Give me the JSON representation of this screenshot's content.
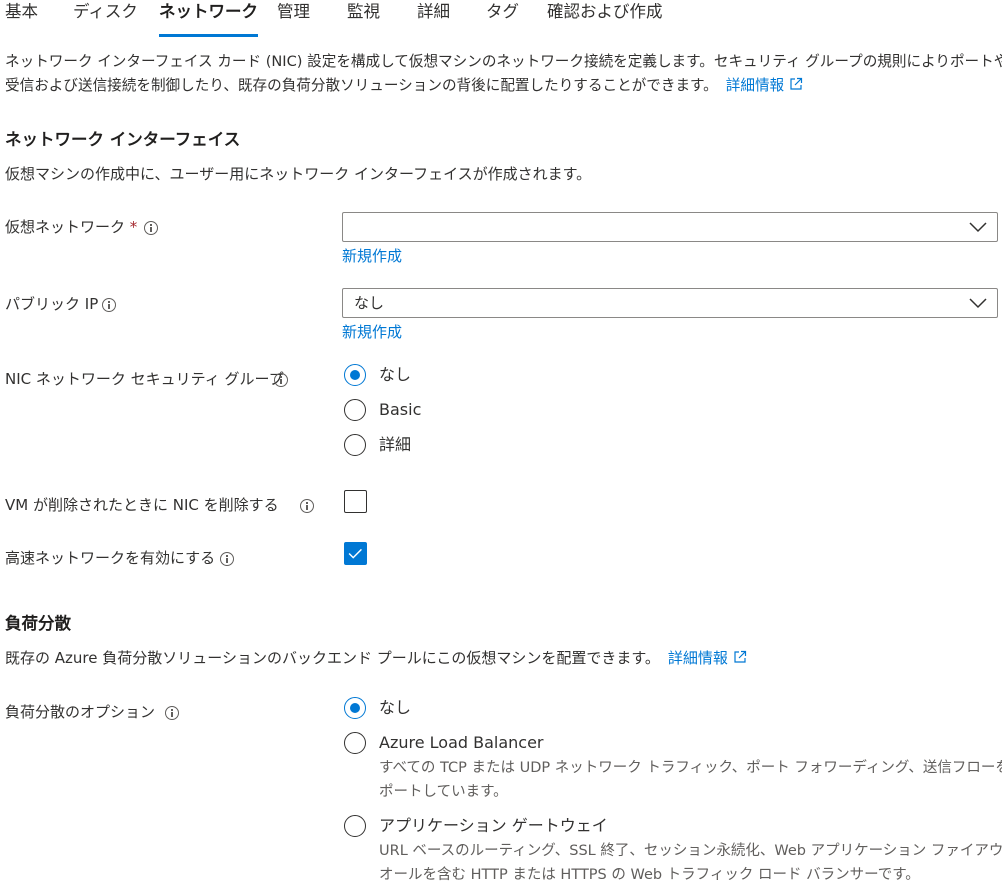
{
  "tabs": [
    {
      "label": "基本",
      "active": false
    },
    {
      "label": "ディスク",
      "active": false
    },
    {
      "label": "ネットワーク",
      "active": true
    },
    {
      "label": "管理",
      "active": false
    },
    {
      "label": "監視",
      "active": false
    },
    {
      "label": "詳細",
      "active": false
    },
    {
      "label": "タグ",
      "active": false
    },
    {
      "label": "確認および作成",
      "active": false
    }
  ],
  "intro": {
    "line1": "ネットワーク インターフェイス カード (NIC) 設定を構成して仮想マシンのネットワーク接続を定義します。セキュリティ グループの規則によりポートや",
    "line2": "受信および送信接続を制御したり、既存の負荷分散ソリューションの背後に配置したりすることができます。",
    "learn_more": "詳細情報"
  },
  "nic_section": {
    "heading": "ネットワーク インターフェイス",
    "description": "仮想マシンの作成中に、ユーザー用にネットワーク インターフェイスが作成されます。"
  },
  "virtual_network": {
    "label": "仮想ネットワーク",
    "required_mark": "*",
    "value": "",
    "create_new": "新規作成"
  },
  "public_ip": {
    "label": "パブリック IP",
    "value": "なし",
    "create_new": "新規作成"
  },
  "nic_nsg": {
    "label": "NIC ネットワーク セキュリティ グループ",
    "options": [
      "なし",
      "Basic",
      "詳細"
    ],
    "selected": "なし"
  },
  "delete_nic": {
    "label": "VM が削除されたときに NIC を削除する",
    "checked": false
  },
  "accelerated_networking": {
    "label": "高速ネットワークを有効にする",
    "checked": true
  },
  "lb_section": {
    "heading": "負荷分散",
    "description": "既存の Azure 負荷分散ソリューションのバックエンド プールにこの仮想マシンを配置できます。",
    "learn_more": "詳細情報"
  },
  "lb_options": {
    "label": "負荷分散のオプション",
    "selected": "なし",
    "options": [
      {
        "label": "なし",
        "desc1": "",
        "desc2": ""
      },
      {
        "label": "Azure Load Balancer",
        "desc1": "すべての TCP または UDP ネットワーク トラフィック、ポート フォワーディング、送信フローをサ",
        "desc2": "ポートしています。"
      },
      {
        "label": "アプリケーション ゲートウェイ",
        "desc1": "URL ベースのルーティング、SSL 終了、セッション永続化、Web アプリケーション ファイアウ",
        "desc2": "オールを含む HTTP または HTTPS の Web トラフィック ロード バランサーです。"
      }
    ]
  },
  "colors": {
    "accent": "#0078d4",
    "text": "#323130",
    "required": "#a4262c"
  }
}
